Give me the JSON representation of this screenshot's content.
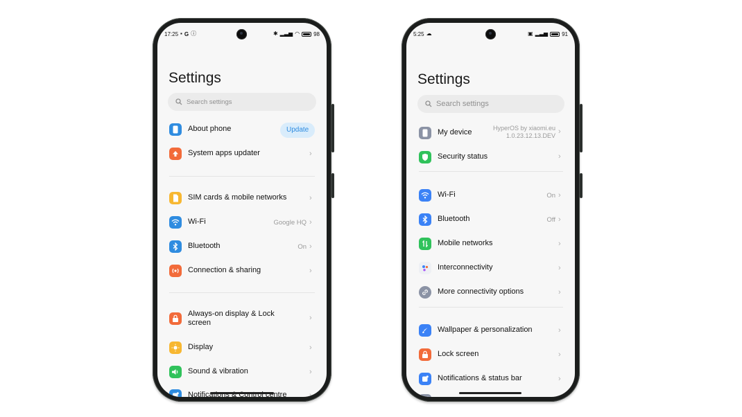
{
  "left_phone": {
    "status": {
      "time": "17:25",
      "g_letter": "G",
      "battery": "98"
    },
    "title": "Settings",
    "search_placeholder": "Search settings",
    "about_phone": {
      "label": "About phone",
      "action": "Update"
    },
    "system_apps_updater": {
      "label": "System apps updater"
    },
    "sim_cards": {
      "label": "SIM cards & mobile networks"
    },
    "wifi": {
      "label": "Wi-Fi",
      "value": "Google HQ"
    },
    "bluetooth": {
      "label": "Bluetooth",
      "value": "On"
    },
    "connection_sharing": {
      "label": "Connection & sharing"
    },
    "always_on_display": {
      "label": "Always-on display & Lock screen"
    },
    "display": {
      "label": "Display"
    },
    "sound": {
      "label": "Sound & vibration"
    },
    "notifications": {
      "label": "Notifications & Control centre"
    }
  },
  "right_phone": {
    "status": {
      "time": "5:25",
      "battery": "91"
    },
    "title": "Settings",
    "search_placeholder": "Search settings",
    "my_device": {
      "label": "My device",
      "value_line1": "HyperOS by xiaomi.eu",
      "value_line2": "1.0.23.12.13.DEV"
    },
    "security_status": {
      "label": "Security status"
    },
    "wifi": {
      "label": "Wi-Fi",
      "value": "On"
    },
    "bluetooth": {
      "label": "Bluetooth",
      "value": "Off"
    },
    "mobile_networks": {
      "label": "Mobile networks"
    },
    "interconnectivity": {
      "label": "Interconnectivity"
    },
    "more_connectivity": {
      "label": "More connectivity options"
    },
    "wallpaper": {
      "label": "Wallpaper & personalization"
    },
    "lock_screen": {
      "label": "Lock screen"
    },
    "notifications_status_bar": {
      "label": "Notifications & status bar"
    }
  },
  "colors": {
    "blue": "#2f8ce0",
    "orange": "#f26b3a",
    "yellow": "#f7b731",
    "green": "#30c25b",
    "gray": "#8b93a5",
    "hyper_blue": "#3b82f6"
  }
}
